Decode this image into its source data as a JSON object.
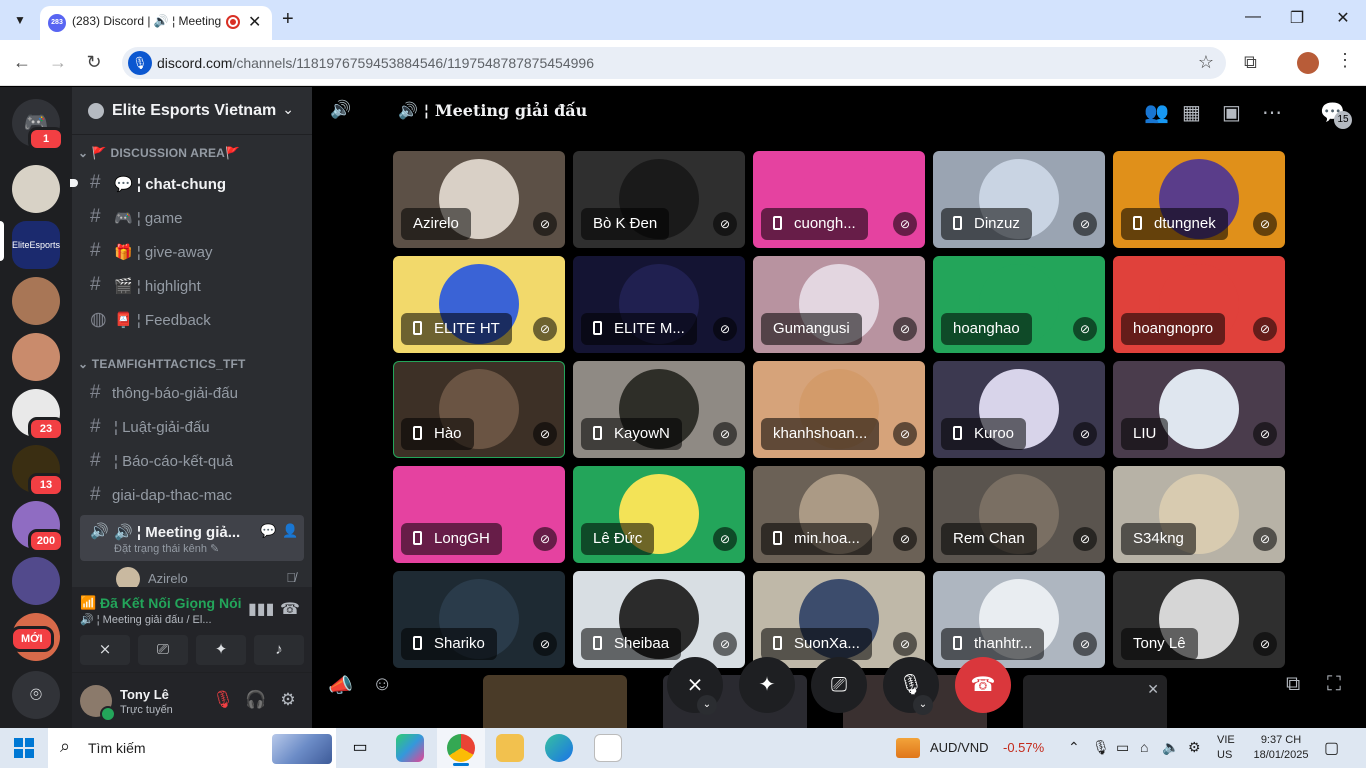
{
  "browser": {
    "tab_title": "(283) Discord | 🔊 ¦ Meeting",
    "tab_badge": "283",
    "url_host": "discord.com",
    "url_path": "/channels/1181976759453884546/1197548787875454996",
    "menu_icon": "chevron-down-icon",
    "new_tab_label": "+"
  },
  "servers": {
    "home_badge": "1",
    "badges": [
      "23",
      "13",
      "200"
    ],
    "new_label": "MỚI"
  },
  "guild": {
    "name": "Elite Esports Vietnam"
  },
  "categories": [
    {
      "label": "🚩 DISCUSSION AREA🚩"
    },
    {
      "label": "TEAMFIGHTTACTICS_TFT"
    }
  ],
  "channels": [
    {
      "name": "💬 ¦ chat-chung",
      "bold": true
    },
    {
      "name": "🎮 ¦ game"
    },
    {
      "name": "🎁 ¦ give-away"
    },
    {
      "name": "🎬 ¦ highlight"
    },
    {
      "name": "📮 ¦ Feedback"
    },
    {
      "name": "thông-báo-giải-đấu"
    },
    {
      "name": "¦ Luật-giải-đấu"
    },
    {
      "name": "¦ Báo-cáo-kết-quả"
    },
    {
      "name": "giai-dap-thac-mac"
    },
    {
      "name": "🔊 ¦ Meeting giả...",
      "sub": "Đặt trạng thái kênh ✎"
    }
  ],
  "voice_member": "Azirelo",
  "rtc": {
    "status": "Đã Kết Nối Giọng Nói",
    "channel": "🔊 ¦ Meeting giải đấu / El..."
  },
  "user": {
    "name": "Tony Lê",
    "status": "Trực tuyến"
  },
  "stage": {
    "title": "🔊 ¦ Meeting giải đấu",
    "people_count": "15"
  },
  "participants": [
    {
      "name": "Azirelo",
      "mobile": false,
      "bg": "#5c5046",
      "av": "#d9d0c6"
    },
    {
      "name": "Bò K Đen",
      "mobile": false,
      "bg": "#2f2f2f",
      "av": "#1a1a1a"
    },
    {
      "name": "cuongh...",
      "mobile": true,
      "bg": "#e542a0",
      "av": "#e542a0"
    },
    {
      "name": "Dinzuz",
      "mobile": true,
      "bg": "#9aa4b2",
      "av": "#c9d4e3"
    },
    {
      "name": "dtungnek",
      "mobile": true,
      "bg": "#e0901a",
      "av": "#5a3d8a"
    },
    {
      "name": "ELITE HT",
      "mobile": true,
      "bg": "#f2d96b",
      "av": "#3a63d6"
    },
    {
      "name": "ELITE M...",
      "mobile": true,
      "bg": "#141433",
      "av": "#202050"
    },
    {
      "name": "Gumangusi",
      "mobile": false,
      "bg": "#b893a0",
      "av": "#e3d6e0"
    },
    {
      "name": "hoanghao",
      "mobile": false,
      "bg": "#23a55a",
      "av": "#23a55a"
    },
    {
      "name": "hoangnopro",
      "mobile": false,
      "bg": "#e0413b",
      "av": "#e0413b"
    },
    {
      "name": "Hào",
      "mobile": true,
      "bg": "#3d3026",
      "av": "#6a5443"
    },
    {
      "name": "KayowN",
      "mobile": true,
      "bg": "#8f8a84",
      "av": "#2e2e28"
    },
    {
      "name": "khanhshoan...",
      "mobile": false,
      "bg": "#d6a37a",
      "av": "#d39b6a"
    },
    {
      "name": "Kuroo",
      "mobile": true,
      "bg": "#3c3950",
      "av": "#d8d4ea"
    },
    {
      "name": "LIU",
      "mobile": false,
      "bg": "#4a3c4c",
      "av": "#dfe6ef"
    },
    {
      "name": "LongGH",
      "mobile": true,
      "bg": "#e542a0",
      "av": "#e542a0"
    },
    {
      "name": "Lê Đức",
      "mobile": false,
      "bg": "#23a55a",
      "av": "#f3e357"
    },
    {
      "name": "min.hoa...",
      "mobile": true,
      "bg": "#6b6156",
      "av": "#ab9a85"
    },
    {
      "name": "Rem Chan",
      "mobile": false,
      "bg": "#5a544e",
      "av": "#7a6f63"
    },
    {
      "name": "S34kng",
      "mobile": false,
      "bg": "#b7b2a6",
      "av": "#d8cbb0"
    },
    {
      "name": "Shariko",
      "mobile": true,
      "bg": "#1e2a33",
      "av": "#2a3b4a"
    },
    {
      "name": "Sheibaa",
      "mobile": true,
      "bg": "#d8dee3",
      "av": "#2b2b2b"
    },
    {
      "name": "SuonXa...",
      "mobile": true,
      "bg": "#bfb8a8",
      "av": "#3c4c6c"
    },
    {
      "name": "thanhtr...",
      "mobile": true,
      "bg": "#aeb6c0",
      "av": "#e9edf1"
    },
    {
      "name": "Tony Lê",
      "mobile": false,
      "bg": "#2f2f2f",
      "av": "#d6d6d6"
    }
  ],
  "taskbar": {
    "search_placeholder": "Tìm kiếm",
    "ticker_name": "AUD/VND",
    "ticker_value": "-0.57%",
    "lang_top": "VIE",
    "lang_bottom": "US",
    "time": "9:37 CH",
    "date": "18/01/2025"
  },
  "colors": {
    "blurple": "#5865f2",
    "green": "#23a55a",
    "red": "#f23f43"
  }
}
